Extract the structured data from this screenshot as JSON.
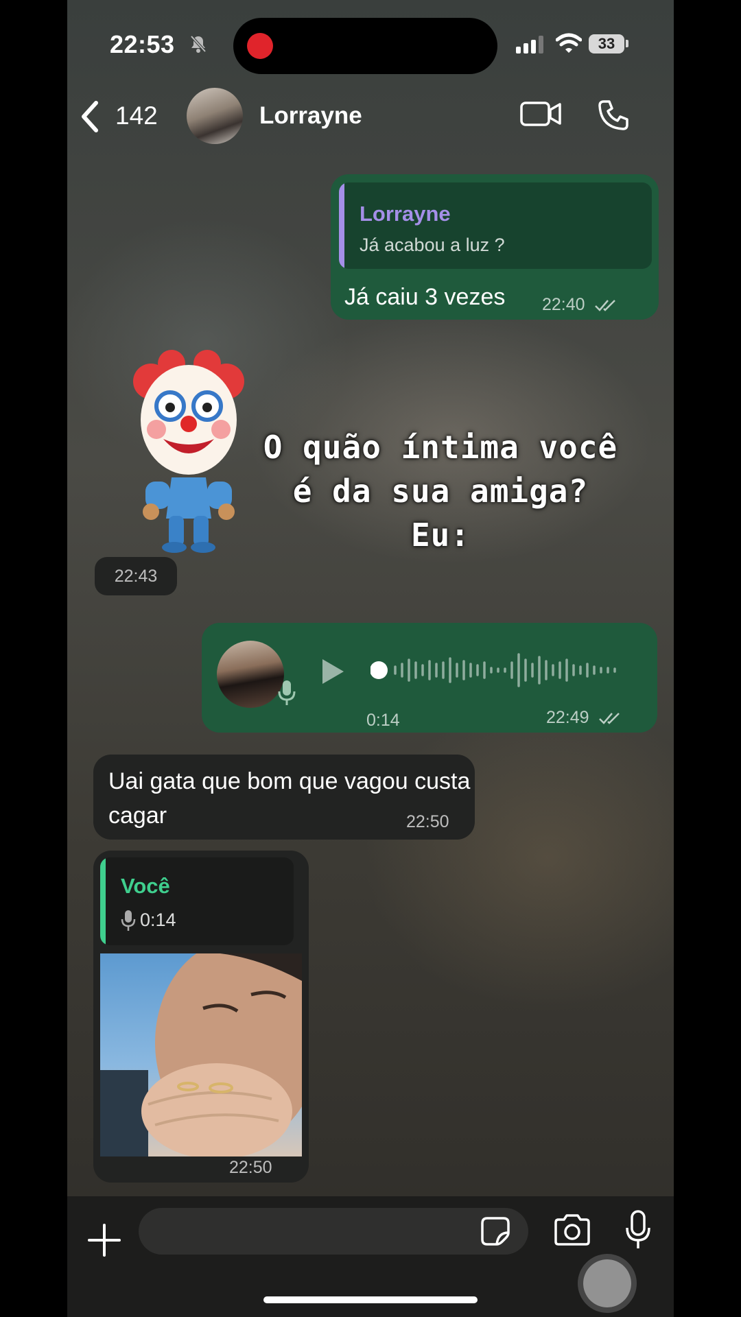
{
  "status_bar": {
    "time": "22:53",
    "battery": "33"
  },
  "header": {
    "unread_count": "142",
    "contact_name": "Lorrayne"
  },
  "messages": {
    "m1": {
      "reply_author": "Lorrayne",
      "reply_text": "Já acabou a luz ?",
      "text": "Já caiu 3 vezes",
      "time": "22:40"
    },
    "sticker": {
      "time": "22:43"
    },
    "voice": {
      "duration": "0:14",
      "time": "22:49"
    },
    "m3": {
      "text": "Uai gata que bom que vagou custa cagar",
      "time": "22:50"
    },
    "m4": {
      "reply_author": "Você",
      "reply_duration": "0:14",
      "time": "22:50"
    }
  },
  "overlay_caption": {
    "line1": "O quão íntima você",
    "line2": "é da sua amiga?",
    "line3": "Eu:"
  },
  "colors": {
    "outgoing_bubble": "#1f5a3c",
    "incoming_bubble": "#222322",
    "reply_accent_contact": "#a48fe8",
    "reply_accent_you": "#3fcf8e"
  }
}
